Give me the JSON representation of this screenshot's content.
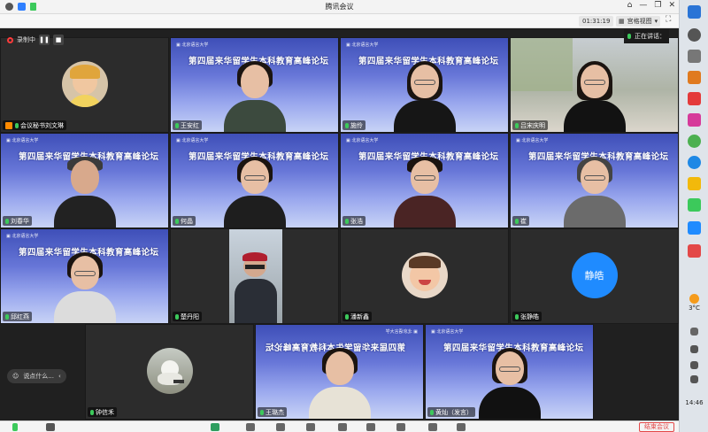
{
  "app": {
    "title": "腾讯会议"
  },
  "infobar": {
    "timer": "01:31:19",
    "view_label": "宫格视图"
  },
  "recording": {
    "label": "录制中"
  },
  "speaking": {
    "label": "正在讲话："
  },
  "banner_title": "第四届来华留学生本科教育高峰论坛",
  "participants": [
    {
      "name": "会议秘书刘文琳",
      "mic": "on",
      "host": true
    },
    {
      "name": "王安红",
      "mic": "on"
    },
    {
      "name": "施伶",
      "mic": "on"
    },
    {
      "name": "吕宋庆明",
      "mic": "on"
    },
    {
      "name": "刘春华",
      "mic": "on"
    },
    {
      "name": "何晶",
      "mic": "on"
    },
    {
      "name": "张浩",
      "mic": "on"
    },
    {
      "name": "崔",
      "mic": "on"
    },
    {
      "name": "邱红燕",
      "mic": "on"
    },
    {
      "name": "楚丹阳",
      "mic": "on"
    },
    {
      "name": "潘新鑫",
      "mic": "on"
    },
    {
      "name": "张静皓",
      "mic": "on",
      "avatar_text": "静皓"
    },
    {
      "name": "钟信禾",
      "mic": "on"
    },
    {
      "name": "王璐杰",
      "mic": "on"
    },
    {
      "name": "黄灿（发言）",
      "mic": "on"
    }
  ],
  "chat": {
    "placeholder": "说点什么..."
  },
  "toolbar": {
    "end_label": "结束会议"
  },
  "taskbar": {
    "temperature": "3°C",
    "time": "14:46"
  },
  "colors": {
    "accent": "#1f8bff",
    "banner": "#4b5bc7",
    "mic_on": "#3cc95b",
    "end": "#e34848"
  }
}
